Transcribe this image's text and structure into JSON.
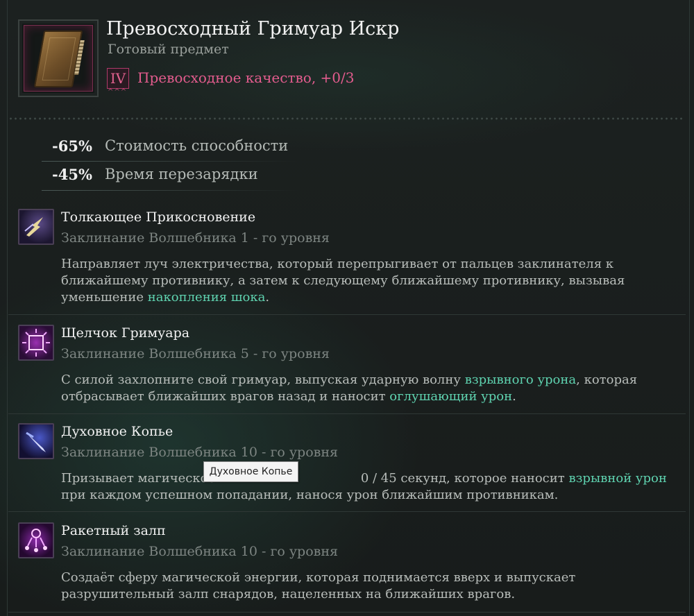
{
  "item": {
    "title": "Превосходный Гримуар Искр",
    "subtitle": "Готовый предмет",
    "tier": "IV",
    "tier_dots": "^^^",
    "quality": "Превосходное качество, +0/3",
    "colors": {
      "quality": "#e45c8e",
      "keyword": "#5fd3b0",
      "border": "#7a2f4f"
    }
  },
  "stats": [
    {
      "value": "-65%",
      "label": "Стоимость способности"
    },
    {
      "value": "-45%",
      "label": "Время перезарядки"
    }
  ],
  "spells": [
    {
      "icon": "lightning-bolt-icon",
      "name": "Толкающее Прикосновение",
      "level": "Заклинание Волшебника 1 - го уровня",
      "desc_parts": [
        "Направляет луч электричества, который перепрыгивает от пальцев заклинателя к ближайшему противнику, а затем к следующему ближайшему противнику, вызывая уменьшение ",
        "накопления шока",
        "."
      ]
    },
    {
      "icon": "grimoire-burst-icon",
      "name": "Щелчок Гримуара",
      "level": "Заклинание Волшебника 5 - го уровня",
      "desc_parts": [
        "С силой захлопните свой гримуар, выпуская ударную волну ",
        "взрывного урона",
        ", которая отбрасывает ближайших врагов назад и наносит ",
        "оглушающий урон",
        "."
      ]
    },
    {
      "icon": "spirit-spear-icon",
      "name": "Духовное Копье",
      "level": "Заклинание Волшебника 10 - го уровня",
      "desc_parts": [
        "Призывает магическое ",
        "",
        "0 / 45 секунд, которое наносит ",
        "взрывной урон",
        " при каждом успешном попадании, нанося урон ближайшим противникам."
      ]
    },
    {
      "icon": "missile-volley-icon",
      "name": "Ракетный залп",
      "level": "Заклинание Волшебника 10 - го уровня",
      "desc_parts": [
        "Создаёт сферу магической энергии, которая поднимается вверх и выпускает разрушительный залп снарядов, нацеленных на ближайших врагов."
      ]
    }
  ],
  "tooltip": "Духовное Копье"
}
